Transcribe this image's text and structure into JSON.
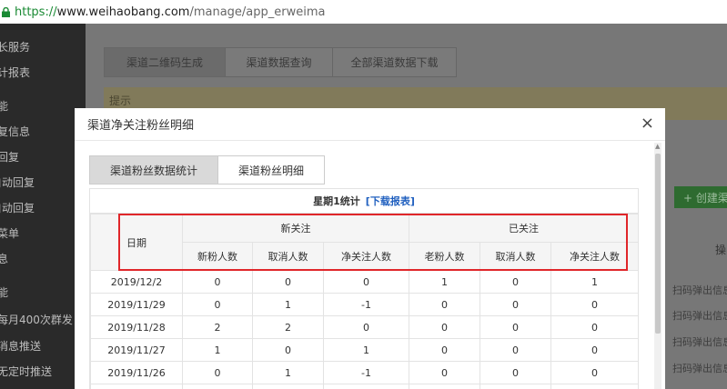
{
  "browser": {
    "url_scheme": "https://",
    "url_host": "www.weihaobang.com",
    "url_path": "/manage/app_erweima"
  },
  "sidebar": {
    "items": [
      "长服务",
      "计报表",
      "能",
      "复信息",
      "回复",
      "自动回复",
      "自动回复",
      "菜单",
      "息",
      "能",
      "每月400次群发",
      "消息推送",
      "无定时推送"
    ]
  },
  "background": {
    "tabs": [
      "渠道二维码生成",
      "渠道数据查询",
      "全部渠道数据下载"
    ],
    "tip_label": "提示",
    "create_button": "+ 创建渠",
    "op_header": "操",
    "row_action": "扫码弹出信息"
  },
  "modal": {
    "title": "渠道净关注粉丝明细",
    "close": "×",
    "tabs": [
      "渠道粉丝数据统计",
      "渠道粉丝明细"
    ],
    "caption": "星期1统计",
    "download_link": "[下载报表]",
    "headers": {
      "date": "日期",
      "new_follow": "新关注",
      "followed": "已关注",
      "sub": [
        "新粉人数",
        "取消人数",
        "净关注人数",
        "老粉人数",
        "取消人数",
        "净关注人数"
      ]
    },
    "rows": [
      [
        "2019/12/2",
        "0",
        "0",
        "0",
        "1",
        "0",
        "1"
      ],
      [
        "2019/11/29",
        "0",
        "1",
        "-1",
        "0",
        "0",
        "0"
      ],
      [
        "2019/11/28",
        "2",
        "2",
        "0",
        "0",
        "0",
        "0"
      ],
      [
        "2019/11/27",
        "1",
        "0",
        "1",
        "0",
        "0",
        "0"
      ],
      [
        "2019/11/26",
        "0",
        "1",
        "-1",
        "0",
        "0",
        "0"
      ],
      [
        "",
        "",
        "",
        "",
        "",
        "",
        ""
      ]
    ]
  }
}
